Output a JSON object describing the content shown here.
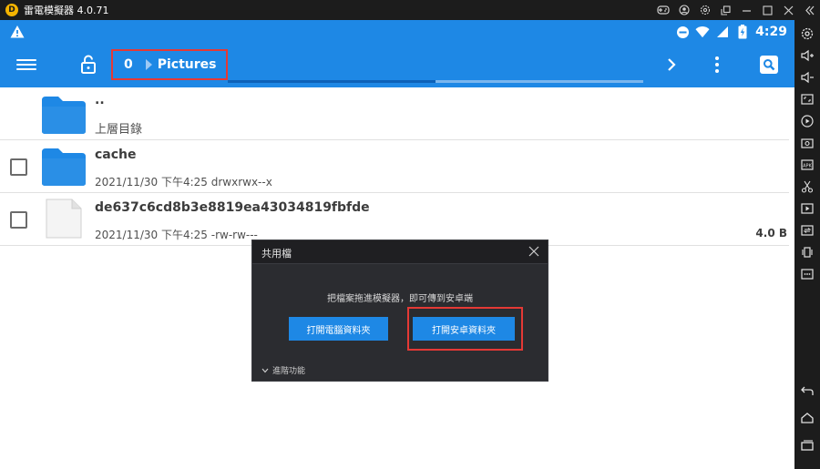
{
  "window": {
    "title": "雷電模擬器 4.0.71",
    "controls": [
      "gamepad-icon",
      "user-icon",
      "settings-icon",
      "restore-icon",
      "minimize-icon",
      "maximize-icon",
      "close-icon",
      "collapse-icon"
    ]
  },
  "status_bar": {
    "time": "4:29",
    "accent": "#1e88e5"
  },
  "toolbar": {
    "breadcrumb_index": "0",
    "breadcrumb_folder": "Pictures",
    "progress": 0.5
  },
  "files": {
    "parent": {
      "name": "..",
      "label": "上層目錄"
    },
    "items": [
      {
        "name": "cache",
        "meta": "2021/11/30 下午4:25   drwxrwx--x",
        "size": "",
        "type": "folder"
      },
      {
        "name": "de637c6cd8b3e8819ea43034819fbfde",
        "meta": "2021/11/30 下午4:25   -rw-rw---",
        "size": "4.0 B",
        "type": "file"
      }
    ]
  },
  "dialog": {
    "title": "共用檔",
    "hint": "把檔案拖進模擬器，即可傳到安卓端",
    "btn_pc": "打開電腦資料夾",
    "btn_android": "打開安卓資料夾",
    "advanced": "進階功能"
  },
  "sidebar": {
    "buttons": [
      "settings-gear-icon",
      "volume-up-icon",
      "volume-down-icon",
      "screen-resize-icon",
      "record-icon",
      "screenshot-icon",
      "apk-install-icon",
      "scissors-icon",
      "video-play-icon",
      "sync-icon",
      "shake-icon",
      "more-icon",
      "back-icon",
      "home-icon",
      "recent-apps-icon"
    ]
  }
}
